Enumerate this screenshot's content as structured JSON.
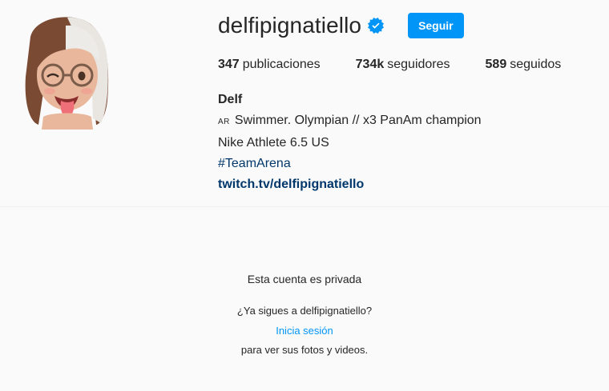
{
  "profile": {
    "username": "delfipignatiello",
    "follow_label": "Seguir",
    "stats": [
      {
        "count": "347",
        "label": "publicaciones"
      },
      {
        "count": "734k",
        "label": "seguidores"
      },
      {
        "count": "589",
        "label": "seguidos"
      }
    ],
    "bio": {
      "name": "Delf",
      "flag": "AR",
      "line1": "Swimmer. Olympian // x3 PanAm champion",
      "line2": "Nike Athlete 6.5 US",
      "hashtag": "#TeamArena",
      "link": "twitch.tv/delfipignatiello"
    }
  },
  "private_notice": {
    "title": "Esta cuenta es privada",
    "question": "¿Ya sigues a delfipignatiello?",
    "login_label": "Inicia sesión",
    "subtitle": "para ver sus fotos y videos."
  },
  "icons": {
    "verified": "verified-badge-icon",
    "avatar": "memoji-avatar"
  },
  "colors": {
    "accent": "#0095f6",
    "link": "#00376b",
    "background": "#fafafa",
    "text": "#262626"
  }
}
